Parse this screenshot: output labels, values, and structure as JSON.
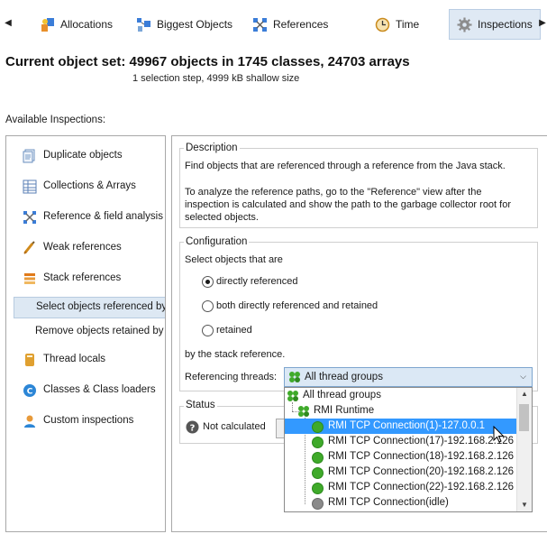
{
  "toolbar": {
    "tabs": [
      {
        "label": "Allocations",
        "icon": "allocations-icon"
      },
      {
        "label": "Biggest Objects",
        "icon": "biggest-objects-icon"
      },
      {
        "label": "References",
        "icon": "references-icon"
      },
      {
        "label": "Time",
        "icon": "clock-icon"
      },
      {
        "label": "Inspections",
        "icon": "gear-icon"
      }
    ],
    "active_tab": "Inspections",
    "left_arrow": "◀",
    "right_arrow": "▶"
  },
  "header": {
    "title": "Current object set:  49967 objects in 1745 classes, 24703 arrays",
    "subtitle": "1 selection step, 4999 kB shallow size"
  },
  "available_label": "Available Inspections:",
  "inspections": [
    {
      "label": "Duplicate objects",
      "icon": "duplicate-objects-icon"
    },
    {
      "label": "Collections & Arrays",
      "icon": "collections-icon"
    },
    {
      "label": "Reference & field analysis",
      "icon": "reference-analysis-icon"
    },
    {
      "label": "Weak references",
      "icon": "weak-references-icon"
    },
    {
      "label": "Stack references",
      "icon": "stack-references-icon"
    },
    {
      "label": "Select objects referenced by t",
      "icon": "",
      "sub": true,
      "selected": true
    },
    {
      "label": "Remove objects retained by st",
      "icon": "",
      "sub": true
    },
    {
      "label": "Thread locals",
      "icon": "thread-locals-icon"
    },
    {
      "label": "Classes & Class loaders",
      "icon": "class-loaders-icon"
    },
    {
      "label": "Custom inspections",
      "icon": "custom-inspections-icon"
    }
  ],
  "description": {
    "label": "Description",
    "line1": "Find objects that are referenced through a reference from the Java stack.",
    "line2": "To analyze the reference paths, go to the \"Reference\" view after the",
    "line3": "inspection is calculated and show the path to the garbage collector root for",
    "line4": "selected objects."
  },
  "configuration": {
    "label": "Configuration",
    "select_text": "Select objects that are",
    "options": [
      {
        "label": "directly referenced",
        "checked": true
      },
      {
        "label": "both directly referenced and retained",
        "checked": false
      },
      {
        "label": "retained",
        "checked": false
      }
    ],
    "by_text": "by the stack reference.",
    "threads_label": "Referencing threads:",
    "threads_value": "All thread groups"
  },
  "dropdown": {
    "items": [
      {
        "label": "All thread groups",
        "level": 0,
        "icon": "thread-group-icon"
      },
      {
        "label": "RMI Runtime",
        "level": 1,
        "icon": "thread-group-icon"
      },
      {
        "label": "RMI TCP Connection(1)-127.0.0.1",
        "level": 2,
        "icon": "green-thread-icon",
        "highlighted": true
      },
      {
        "label": "RMI TCP Connection(17)-192.168.2.126",
        "level": 2,
        "icon": "green-thread-icon"
      },
      {
        "label": "RMI TCP Connection(18)-192.168.2.126",
        "level": 2,
        "icon": "green-thread-icon"
      },
      {
        "label": "RMI TCP Connection(20)-192.168.2.126",
        "level": 2,
        "icon": "green-thread-icon"
      },
      {
        "label": "RMI TCP Connection(22)-192.168.2.126",
        "level": 2,
        "icon": "green-thread-icon"
      },
      {
        "label": "RMI TCP Connection(idle)",
        "level": 2,
        "icon": "gray-thread-icon"
      }
    ]
  },
  "status": {
    "label": "Status",
    "value": "Not calculated",
    "icon": "question-icon"
  },
  "colors": {
    "accent": "#3399ff",
    "selection": "#dde8f3",
    "thread_green": "#3faa2a",
    "thread_gray": "#8a8a8a"
  }
}
